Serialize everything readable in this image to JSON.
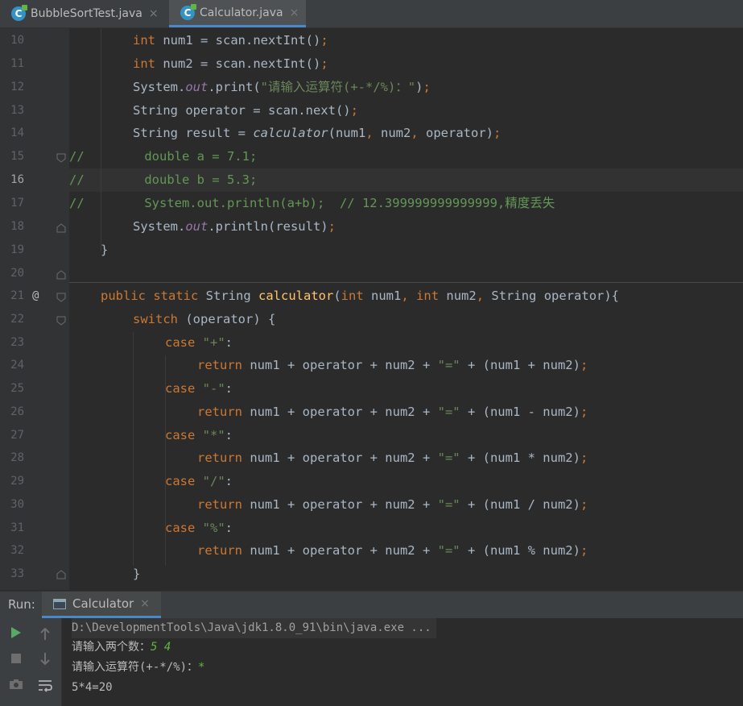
{
  "tabs": [
    {
      "label": "BubbleSortTest.java",
      "active": false,
      "icon": "java-class-icon"
    },
    {
      "label": "Calculator.java",
      "active": true,
      "icon": "java-class-icon"
    }
  ],
  "tab_close_glyph": "×",
  "editor": {
    "current_line": "16",
    "gutter_marker": "@",
    "lines": [
      {
        "num": "10"
      },
      {
        "num": "11"
      },
      {
        "num": "12"
      },
      {
        "num": "13"
      },
      {
        "num": "14"
      },
      {
        "num": "15"
      },
      {
        "num": "16"
      },
      {
        "num": "17"
      },
      {
        "num": "18"
      },
      {
        "num": "19"
      },
      {
        "num": "20"
      },
      {
        "num": "21"
      },
      {
        "num": "22"
      },
      {
        "num": "23"
      },
      {
        "num": "24"
      },
      {
        "num": "25"
      },
      {
        "num": "26"
      },
      {
        "num": "27"
      },
      {
        "num": "28"
      },
      {
        "num": "29"
      },
      {
        "num": "30"
      },
      {
        "num": "31"
      },
      {
        "num": "32"
      },
      {
        "num": "33"
      }
    ],
    "code": {
      "l10": {
        "kw": "int",
        "rest": " num1 = scan.nextInt()",
        "semi": ";"
      },
      "l11": {
        "kw": "int",
        "rest": " num2 = scan.nextInt()",
        "semi": ";"
      },
      "l12": {
        "a": "System.",
        "fld": "out",
        "b": ".print(",
        "str": "\"请输入运算符(+-*/%)：\"",
        "c": ")",
        "semi": ";"
      },
      "l13": {
        "text": "String operator = scan.next()",
        "semi": ";"
      },
      "l14": {
        "a": "String result = ",
        "it": "calculator",
        "b": "(num1",
        "c1": ",",
        "d": " num2",
        "c2": ",",
        "e": " operator)",
        "semi": ";"
      },
      "l15": {
        "text": "//        double a = 7.1;"
      },
      "l16": {
        "text": "//        double b = 5.3;"
      },
      "l17": {
        "text": "//        System.out.println(a+b);  // 12.399999999999999,精度丢失"
      },
      "l18": {
        "a": "System.",
        "fld": "out",
        "b": ".println(result)",
        "semi": ";"
      },
      "l19": {
        "text": "}"
      },
      "l21": {
        "kw1": "public",
        "kw2": "static",
        "t": " String ",
        "fn": "calculator",
        "p1": "(",
        "kw3": "int",
        "p2": " num1",
        "c1": ",",
        "kw4": "int",
        "p3": " num2",
        "c2": ",",
        "p4": " String operator){"
      },
      "l22": {
        "kw": "switch",
        "rest": " (operator) {"
      },
      "cases": [
        {
          "case": "case",
          "lit": "\"+\"",
          "colon": ":",
          "ret": "return",
          "expr": " num1 + operator + num2 + ",
          "eq": "\"=\"",
          "tail": " + (num1 + num2)",
          "semi": ";"
        },
        {
          "case": "case",
          "lit": "\"-\"",
          "colon": ":",
          "ret": "return",
          "expr": " num1 + operator + num2 + ",
          "eq": "\"=\"",
          "tail": " + (num1 - num2)",
          "semi": ";"
        },
        {
          "case": "case",
          "lit": "\"*\"",
          "colon": ":",
          "ret": "return",
          "expr": " num1 + operator + num2 + ",
          "eq": "\"=\"",
          "tail": " + (num1 * num2)",
          "semi": ";"
        },
        {
          "case": "case",
          "lit": "\"/\"",
          "colon": ":",
          "ret": "return",
          "expr": " num1 + operator + num2 + ",
          "eq": "\"=\"",
          "tail": " + (num1 / num2)",
          "semi": ";"
        },
        {
          "case": "case",
          "lit": "\"%\"",
          "colon": ":",
          "ret": "return",
          "expr": " num1 + operator + num2 + ",
          "eq": "\"=\"",
          "tail": " + (num1 % num2)",
          "semi": ";"
        }
      ],
      "l33": {
        "text": "}"
      }
    }
  },
  "run_panel": {
    "label": "Run:",
    "tab_label": "Calculator",
    "tools": [
      "run-icon",
      "stop-icon",
      "camera-icon",
      "arrow-up-icon",
      "arrow-down-icon",
      "soft-wrap-icon"
    ],
    "console": {
      "command": "D:\\DevelopmentTools\\Java\\jdk1.8.0_91\\bin\\java.exe ...",
      "prompt1": "请输入两个数：",
      "input1": "5 4",
      "prompt2": "请输入运算符(+-*/%)：",
      "input2": "*",
      "result": "5*4=20"
    }
  },
  "colors": {
    "background": "#2b2b2b",
    "keyword": "#cc7832",
    "string": "#6a8759",
    "method": "#ffc66d",
    "field": "#9876aa",
    "accent": "#4a88c7",
    "user_input": "#62b543"
  }
}
